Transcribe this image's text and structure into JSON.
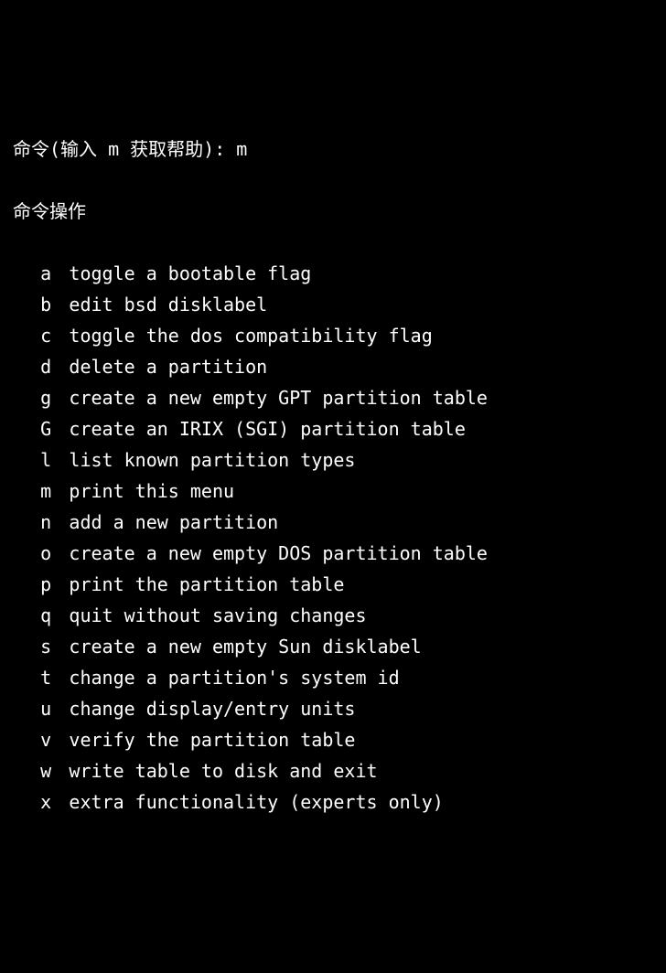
{
  "prompt": {
    "label": "命令(输入 m 获取帮助): ",
    "entered": "m"
  },
  "section_header": "命令操作",
  "commands": [
    {
      "key": "a",
      "desc": "toggle a bootable flag"
    },
    {
      "key": "b",
      "desc": "edit bsd disklabel"
    },
    {
      "key": "c",
      "desc": "toggle the dos compatibility flag"
    },
    {
      "key": "d",
      "desc": "delete a partition"
    },
    {
      "key": "g",
      "desc": "create a new empty GPT partition table"
    },
    {
      "key": "G",
      "desc": "create an IRIX (SGI) partition table"
    },
    {
      "key": "l",
      "desc": "list known partition types"
    },
    {
      "key": "m",
      "desc": "print this menu"
    },
    {
      "key": "n",
      "desc": "add a new partition"
    },
    {
      "key": "o",
      "desc": "create a new empty DOS partition table"
    },
    {
      "key": "p",
      "desc": "print the partition table"
    },
    {
      "key": "q",
      "desc": "quit without saving changes"
    },
    {
      "key": "s",
      "desc": "create a new empty Sun disklabel"
    },
    {
      "key": "t",
      "desc": "change a partition's system id"
    },
    {
      "key": "u",
      "desc": "change display/entry units"
    },
    {
      "key": "v",
      "desc": "verify the partition table"
    },
    {
      "key": "w",
      "desc": "write table to disk and exit"
    },
    {
      "key": "x",
      "desc": "extra functionality (experts only)"
    }
  ]
}
